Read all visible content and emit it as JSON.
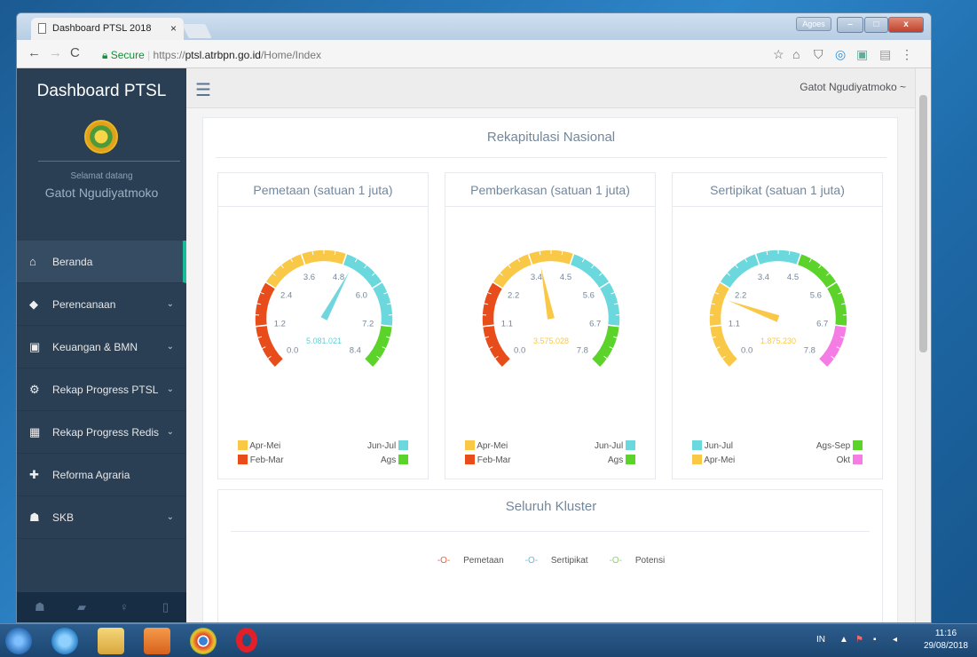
{
  "browser": {
    "tab_title": "Dashboard PTSL 2018",
    "tab_close": "×",
    "user_badge": "Agoes",
    "secure_label": "Secure",
    "url_scheme": "https://",
    "url_domain": "ptsl.atrbpn.go.id",
    "url_path": "/Home/Index"
  },
  "sidebar": {
    "brand": "Dashboard PTSL",
    "welcome": "Selamat datang",
    "user_name": "Gatot Ngudiyatmoko",
    "items": [
      {
        "label": "Beranda",
        "icon": "home-icon",
        "glyph": "⌂",
        "expandable": false,
        "active": true
      },
      {
        "label": "Perencanaan",
        "icon": "diamond-icon",
        "glyph": "◆",
        "expandable": true
      },
      {
        "label": "Keuangan & BMN",
        "icon": "money-icon",
        "glyph": "▣",
        "expandable": true
      },
      {
        "label": "Rekap Progress PTSL",
        "icon": "cogs-icon",
        "glyph": "⚙",
        "expandable": true
      },
      {
        "label": "Rekap Progress Redis",
        "icon": "table-icon",
        "glyph": "▦",
        "expandable": true
      },
      {
        "label": "Reforma Agraria",
        "icon": "gift-icon",
        "glyph": "✚",
        "expandable": false
      },
      {
        "label": "SKB",
        "icon": "users-icon",
        "glyph": "☗",
        "expandable": true
      }
    ]
  },
  "topnav": {
    "user": "Gatot Ngudiyatmoko ~"
  },
  "main": {
    "section_title": "Rekapitulasi Nasional",
    "gauges": [
      {
        "title": "Pemetaan (satuan 1 juta)",
        "value_text": "5.081.021",
        "value": 5.081021,
        "max": 8.4,
        "ticks": [
          "0.0",
          "1.2",
          "2.4",
          "3.6",
          "4.8",
          "6.0",
          "7.2",
          "8.4"
        ],
        "value_color": "#5fd0d8",
        "needle_color": "#6fd6dd",
        "bands": [
          "#e84c1a",
          "#e84c1a",
          "#f9c846",
          "#f9c846",
          "#6bd8de",
          "#6bd8de",
          "#5bd32a"
        ],
        "legend": [
          {
            "label": "Apr-Mei",
            "color": "#f9c846",
            "side": "left"
          },
          {
            "label": "Jun-Jul",
            "color": "#6bd8de",
            "side": "right"
          },
          {
            "label": "Feb-Mar",
            "color": "#e84c1a",
            "side": "left"
          },
          {
            "label": "Ags",
            "color": "#5bd32a",
            "side": "right"
          }
        ]
      },
      {
        "title": "Pemberkasan (satuan 1 juta)",
        "value_text": "3.575.028",
        "value": 3.575028,
        "max": 7.8,
        "ticks": [
          "0.0",
          "1.1",
          "2.2",
          "3.4",
          "4.5",
          "5.6",
          "6.7",
          "7.8"
        ],
        "value_color": "#f9c846",
        "needle_color": "#f9c846",
        "bands": [
          "#e84c1a",
          "#e84c1a",
          "#f9c846",
          "#f9c846",
          "#6bd8de",
          "#6bd8de",
          "#5bd32a"
        ],
        "legend": [
          {
            "label": "Apr-Mei",
            "color": "#f9c846",
            "side": "left"
          },
          {
            "label": "Jun-Jul",
            "color": "#6bd8de",
            "side": "right"
          },
          {
            "label": "Feb-Mar",
            "color": "#e84c1a",
            "side": "left"
          },
          {
            "label": "Ags",
            "color": "#5bd32a",
            "side": "right"
          }
        ]
      },
      {
        "title": "Sertipikat (satuan 1 juta)",
        "value_text": "1.875.230",
        "value": 1.87523,
        "max": 7.8,
        "ticks": [
          "0.0",
          "1.1",
          "2.2",
          "3.4",
          "4.5",
          "5.6",
          "6.7",
          "7.8"
        ],
        "value_color": "#f9c846",
        "needle_color": "#f9c846",
        "bands": [
          "#f9c846",
          "#f9c846",
          "#6bd8de",
          "#6bd8de",
          "#5bd32a",
          "#5bd32a",
          "#f57ce5"
        ],
        "legend": [
          {
            "label": "Jun-Jul",
            "color": "#6bd8de",
            "side": "left"
          },
          {
            "label": "Ags-Sep",
            "color": "#5bd32a",
            "side": "right"
          },
          {
            "label": "Apr-Mei",
            "color": "#f9c846",
            "side": "left"
          },
          {
            "label": "Okt",
            "color": "#f57ce5",
            "side": "right"
          }
        ]
      }
    ],
    "cluster_title": "Seluruh Kluster",
    "cluster_legend": [
      {
        "label": "Pemetaan",
        "color": "#e8623a"
      },
      {
        "label": "Sertipikat",
        "color": "#6bb7d6"
      },
      {
        "label": "Potensi",
        "color": "#8ccf6b"
      }
    ]
  },
  "taskbar": {
    "lang": "IN",
    "time": "11:16",
    "date": "29/08/2018"
  }
}
